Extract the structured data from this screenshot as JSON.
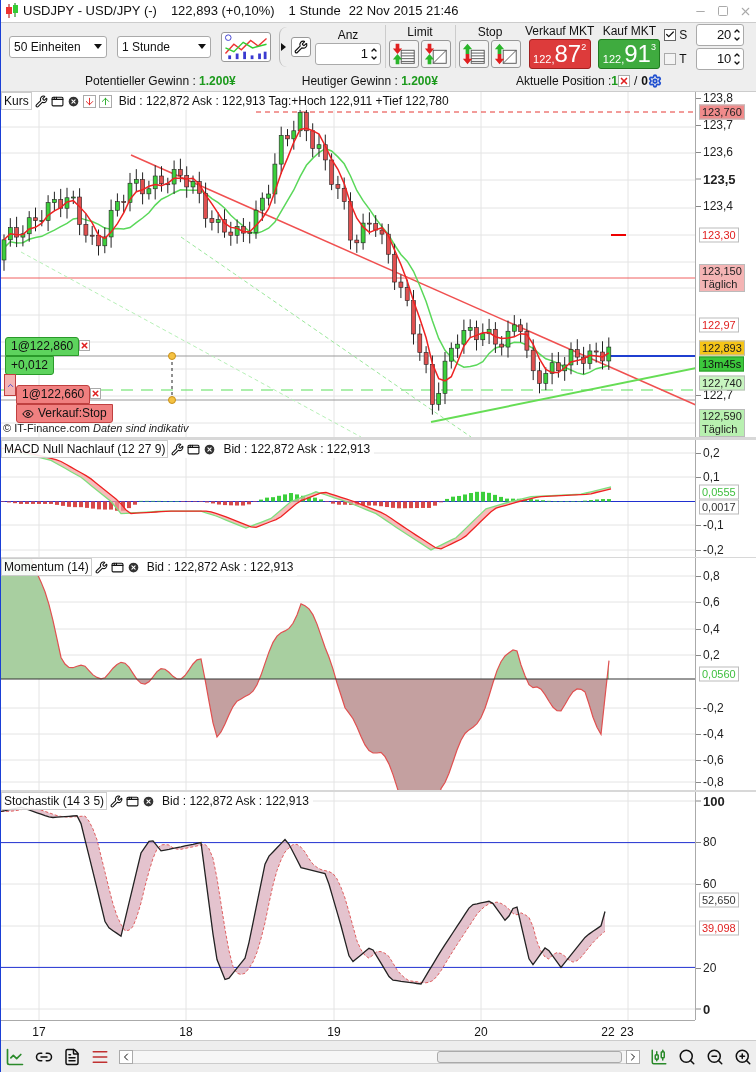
{
  "title_bar": {
    "symbol": "USDJPY - USD/JPY (-)",
    "quote": "122,893 (+0,10%)",
    "period": "1 Stunde",
    "datetime": "22 Nov 2015 21:46"
  },
  "toolbar": {
    "units": "50 Einheiten",
    "period": "1 Stunde",
    "anz": {
      "label": "Anz",
      "value": "1"
    },
    "limit_label": "Limit",
    "stop_label": "Stop",
    "sell": {
      "label": "Verkauf MKT",
      "prefix": "122,",
      "big": "87",
      "sup": "2"
    },
    "buy": {
      "label": "Kauf MKT",
      "prefix": "122,",
      "big": "91",
      "sup": "3"
    },
    "s": {
      "label": "S",
      "checked": true,
      "value": "20"
    },
    "t": {
      "label": "T",
      "checked": false,
      "value": "10"
    }
  },
  "info_bar": {
    "items": [
      {
        "label": "Potentieller Gewinn : ",
        "value": "1.200¥"
      },
      {
        "label": "Heutiger Gewinn : ",
        "value": "1.200¥"
      }
    ],
    "position": {
      "label": "Aktuelle Position : ",
      "long": "1",
      "separator": "/",
      "short": "0"
    }
  },
  "panels": [
    {
      "kind": "price",
      "title": "Kurs",
      "info": "Bid : 122,872 Ask : 122,913 Tag:+Hoch 122,911 +Tief 122,780",
      "ticks": [
        {
          "label": "123,8",
          "major": false
        },
        {
          "label": "123,7",
          "major": false
        },
        {
          "label": "123,6",
          "major": false
        },
        {
          "label": "123,5",
          "major": true
        },
        {
          "label": "123,4",
          "major": false
        },
        {
          "label": "122,7",
          "major": false
        }
      ],
      "markers": [
        {
          "kind": "alert",
          "lines": [
            "123,760"
          ]
        },
        {
          "kind": "level",
          "lines": [
            "123,30"
          ]
        },
        {
          "kind": "daily-high",
          "lines": [
            "123,150",
            "Täglich"
          ]
        },
        {
          "kind": "level",
          "lines": [
            "122,97"
          ]
        },
        {
          "kind": "price",
          "lines": [
            "122,893"
          ]
        },
        {
          "kind": "timer",
          "lines": [
            "13m45s"
          ]
        },
        {
          "kind": "support",
          "lines": [
            "122,740"
          ]
        },
        {
          "kind": "daily-low",
          "lines": [
            "122,590",
            "Täglich"
          ]
        }
      ],
      "orders": [
        {
          "kind": "buy",
          "label": "1@122,860",
          "detail": "+0,012"
        },
        {
          "kind": "sell",
          "label": "1@122,660",
          "detail": "Verkauf:Stop"
        }
      ],
      "footer": "© IT-Finance.com *Daten sind indikativ*"
    },
    {
      "kind": "macd",
      "title": "MACD Null Nachlauf (12 27 9)",
      "info": "Bid : 122,872 Ask : 122,913",
      "ticks": [
        {
          "label": "0,2",
          "major": false
        },
        {
          "label": "0,1",
          "major": false
        },
        {
          "label": "-0,1",
          "major": false
        },
        {
          "label": "-0,2",
          "major": false
        }
      ],
      "markers": [
        {
          "kind": "signal",
          "lines": [
            "0,0555"
          ]
        },
        {
          "kind": "value",
          "lines": [
            "0,0017"
          ]
        }
      ]
    },
    {
      "kind": "momentum",
      "title": "Momentum (14)",
      "info": "Bid : 122,872 Ask : 122,913",
      "ticks": [
        {
          "label": "0,8",
          "major": false
        },
        {
          "label": "0,6",
          "major": false
        },
        {
          "label": "0,4",
          "major": false
        },
        {
          "label": "0,2",
          "major": false
        },
        {
          "label": "-0,2",
          "major": false
        },
        {
          "label": "-0,4",
          "major": false
        },
        {
          "label": "-0,6",
          "major": false
        },
        {
          "label": "-0,8",
          "major": false
        }
      ],
      "markers": [
        {
          "kind": "signal",
          "lines": [
            "0,0560"
          ]
        }
      ]
    },
    {
      "kind": "stochastic",
      "title": "Stochastik (14 3 5)",
      "info": "Bid : 122,872 Ask : 122,913",
      "ticks": [
        {
          "label": "100",
          "major": true
        },
        {
          "label": "80",
          "major": false
        },
        {
          "label": "60",
          "major": false
        },
        {
          "label": "20",
          "major": false
        },
        {
          "label": "0",
          "major": true
        }
      ],
      "markers": [
        {
          "kind": "value",
          "lines": [
            "52,650"
          ]
        },
        {
          "kind": "level",
          "lines": [
            "39,098"
          ]
        }
      ]
    }
  ],
  "x_axis": [
    "17",
    "18",
    "19",
    "20",
    "22",
    "23"
  ]
}
